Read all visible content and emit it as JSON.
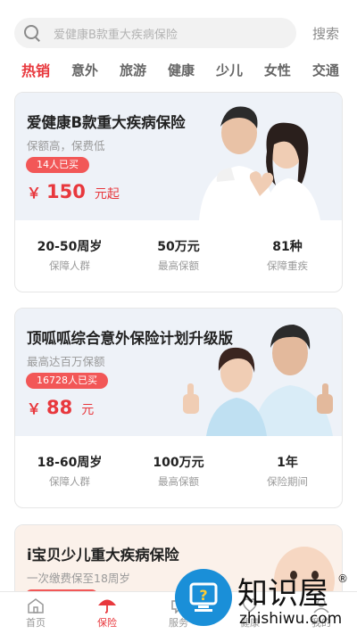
{
  "search": {
    "placeholder": "爱健康B款重大疾病保险",
    "button": "搜索"
  },
  "tabs": [
    "热销",
    "意外",
    "旅游",
    "健康",
    "少儿",
    "女性",
    "交通"
  ],
  "cards": [
    {
      "title": "爱健康B款重大疾病保险",
      "subtitle": "保额高，保费低",
      "badge": "14人已买",
      "currency": "￥",
      "price": "150",
      "unit": "元起",
      "stats": [
        {
          "value": "20-50周岁",
          "label": "保障人群"
        },
        {
          "value": "50万元",
          "label": "最高保额"
        },
        {
          "value": "81种",
          "label": "保障重疾"
        }
      ]
    },
    {
      "title": "顶呱呱综合意外保险计划升级版",
      "subtitle": "最高达百万保额",
      "badge": "16728人已买",
      "currency": "￥",
      "price": "88",
      "unit": "元",
      "stats": [
        {
          "value": "18-60周岁",
          "label": "保障人群"
        },
        {
          "value": "100万元",
          "label": "最高保额"
        },
        {
          "value": "1年",
          "label": "保险期间"
        }
      ]
    },
    {
      "title": "i宝贝少儿重大疾病保险",
      "subtitle": "一次缴费保至18周岁",
      "badge": "",
      "currency": "",
      "price": "",
      "unit": "",
      "stats": []
    }
  ],
  "bottom_nav": [
    {
      "label": "首页",
      "icon": "home-icon"
    },
    {
      "label": "保险",
      "icon": "umbrella-icon"
    },
    {
      "label": "服务",
      "icon": "service-icon"
    },
    {
      "label": "健康",
      "icon": "health-icon"
    },
    {
      "label": "我的",
      "icon": "user-icon"
    }
  ],
  "watermark": {
    "text": "知识屋",
    "domain": "zhishiwu.com",
    "mark": "®"
  },
  "colors": {
    "accent": "#e8383d",
    "badge": "#f25757",
    "card_top_bg": "#eef2f8"
  }
}
